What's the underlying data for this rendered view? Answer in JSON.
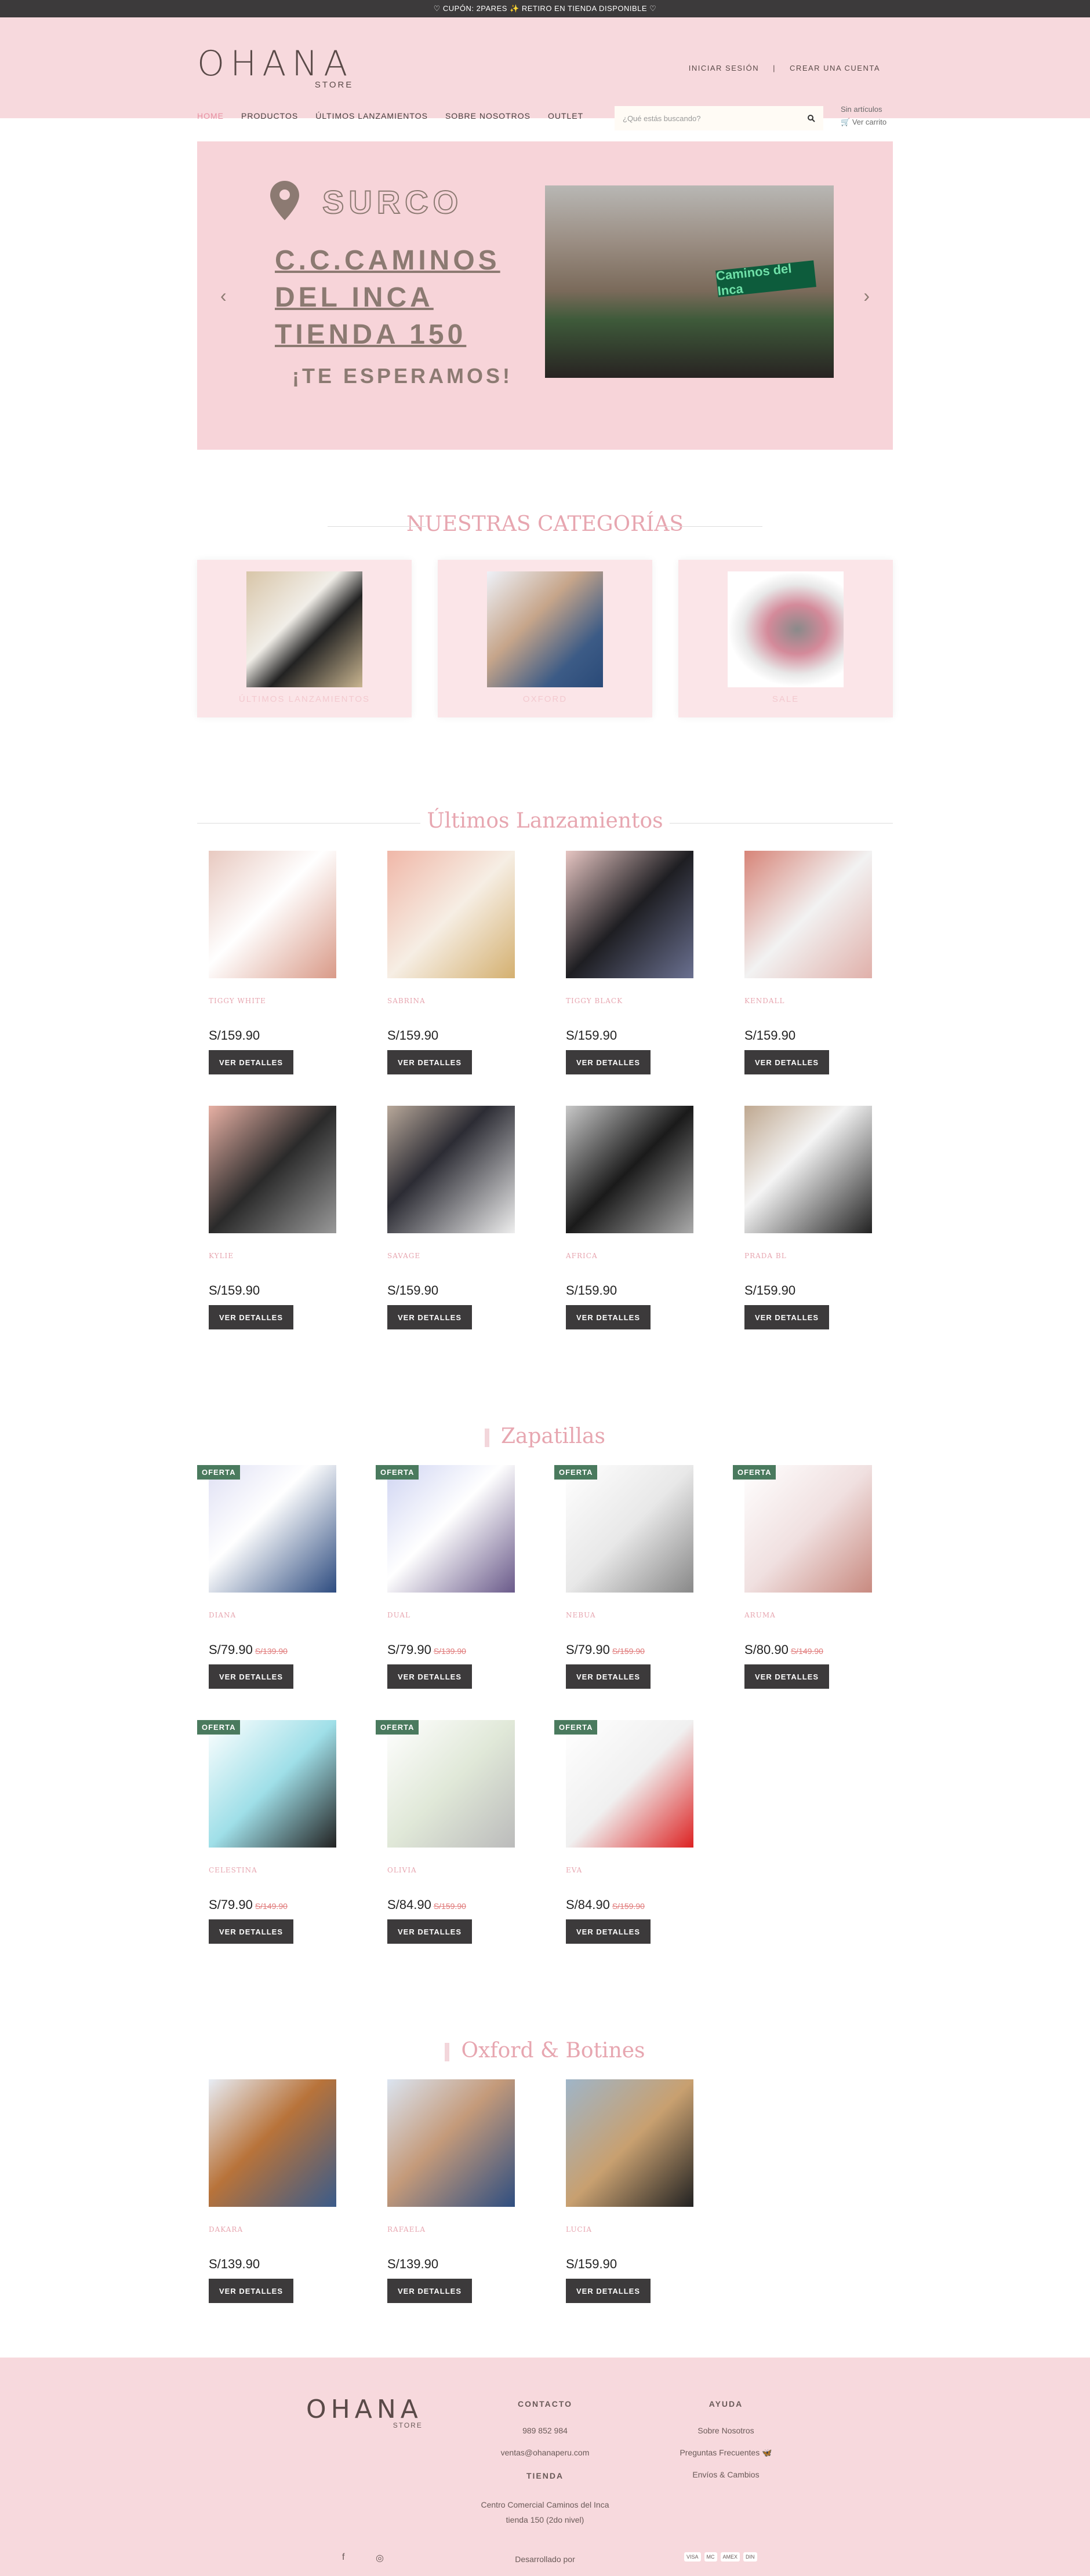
{
  "topbar": {
    "promo": "♡ CUPÓN: 2PARES ✨ RETIRO EN TIENDA DISPONIBLE ♡"
  },
  "header": {
    "brand": "OHANA",
    "brand_sub": "STORE",
    "login": "INICIAR SESIÓN",
    "sep": "|",
    "register": "CREAR UNA CUENTA",
    "nav": [
      "HOME",
      "PRODUCTOS",
      "ÚLTIMOS LANZAMIENTOS",
      "SOBRE NOSOTROS",
      "OUTLET"
    ],
    "search_placeholder": "¿Qué estás buscando?",
    "cart_status": "Sin artículos",
    "cart_link": "Ver carrito"
  },
  "banner": {
    "district": "SURCO",
    "address_lines": [
      "C.C.CAMINOS",
      "DEL INCA",
      "TIENDA 150"
    ],
    "tagline": "¡TE ESPERAMOS!",
    "photo_sign": "Caminos del Inca",
    "prev": "‹",
    "next": "›"
  },
  "categories": {
    "title": "NUESTRAS CATEGORÍAS",
    "items": [
      {
        "label": "ÚLTIMOS LANZAMIENTOS"
      },
      {
        "label": "OXFORD"
      },
      {
        "label": "SALE"
      }
    ]
  },
  "launches": {
    "title": "Últimos Lanzamientos",
    "items": [
      {
        "name": "TIGGY WHITE",
        "price": "S/159.90"
      },
      {
        "name": "SABRINA",
        "price": "S/159.90"
      },
      {
        "name": "TIGGY BLACK",
        "price": "S/159.90"
      },
      {
        "name": "KENDALL",
        "price": "S/159.90"
      },
      {
        "name": "KYLIE",
        "price": "S/159.90"
      },
      {
        "name": "SAVAGE",
        "price": "S/159.90"
      },
      {
        "name": "AFRICA",
        "price": "S/159.90"
      },
      {
        "name": "PRADA BL",
        "price": "S/159.90"
      }
    ]
  },
  "sneakers": {
    "title": "Zapatillas",
    "badge": "OFERTA",
    "items": [
      {
        "name": "DIANA",
        "price": "S/79.90",
        "old": "S/139.90"
      },
      {
        "name": "DUAL",
        "price": "S/79.90",
        "old": "S/139.90"
      },
      {
        "name": "NEBUA",
        "price": "S/79.90",
        "old": "S/159.90"
      },
      {
        "name": "ARUMA",
        "price": "S/80.90",
        "old": "S/149.90"
      },
      {
        "name": "CELESTINA",
        "price": "S/79.90",
        "old": "S/149.90"
      },
      {
        "name": "OLIVIA",
        "price": "S/84.90",
        "old": "S/159.90"
      },
      {
        "name": "EVA",
        "price": "S/84.90",
        "old": "S/159.90"
      }
    ]
  },
  "oxford": {
    "title": "Oxford & Botines",
    "items": [
      {
        "name": "DAKARA",
        "price": "S/139.90"
      },
      {
        "name": "RAFAELA",
        "price": "S/139.90"
      },
      {
        "name": "LUCIA",
        "price": "S/159.90"
      }
    ]
  },
  "button_label": "VER DETALLES",
  "footer": {
    "brand": "OHANA",
    "brand_sub": "STORE",
    "contact_title": "CONTACTO",
    "phone": "989 852 984",
    "email": "ventas@ohanaperu.com",
    "store_title": "TIENDA",
    "store_line1": "Centro Comercial Caminos del Inca",
    "store_line2": "tienda 150 (2do nivel)",
    "help_title": "AYUDA",
    "help_links": [
      "Sobre Nosotros",
      "Preguntas Frecuentes 🦋",
      "Envíos & Cambios"
    ],
    "developed": "Desarrollado por",
    "social": [
      "f",
      "◎"
    ],
    "payments": [
      "VISA",
      "MC",
      "AMEX",
      "DIN"
    ]
  },
  "colors": {
    "pink_bg": "#f7d9dd",
    "accent_pink": "#e7a6b0",
    "dark": "#3c3a3b",
    "offer_green": "#4a7a5e"
  }
}
